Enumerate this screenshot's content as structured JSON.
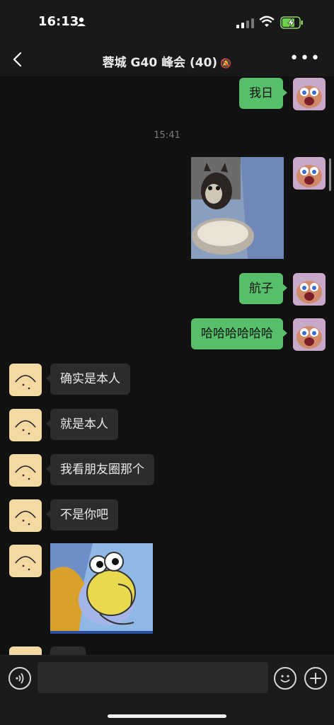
{
  "status": {
    "time": "16:13"
  },
  "header": {
    "title": "蓉城 G40 峰会 (40)",
    "more_icon": "more-icon"
  },
  "chat": {
    "timestamp": "15:41",
    "outgoing": [
      {
        "text": "我日"
      },
      {
        "text": "航子"
      },
      {
        "text": "哈哈哈哈哈哈"
      }
    ],
    "incoming": [
      {
        "text": "确实是本人"
      },
      {
        "text": "就是本人"
      },
      {
        "text": "我看朋友圈那个"
      },
      {
        "text": "不是你吧"
      }
    ]
  },
  "colors": {
    "bubble_out": "#57be6a",
    "bubble_in": "#2c2c2c",
    "background": "#111111"
  },
  "input": {
    "placeholder": ""
  }
}
